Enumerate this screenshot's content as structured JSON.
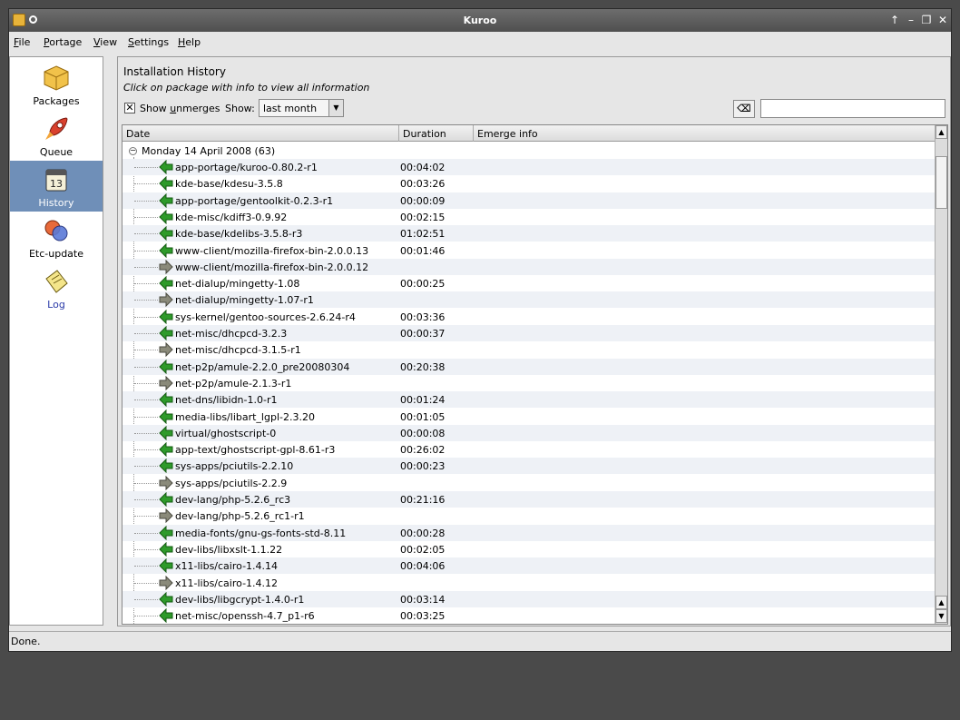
{
  "window": {
    "title": "Kuroo"
  },
  "menu": [
    {
      "key": "F",
      "rest": "ile"
    },
    {
      "key": "P",
      "rest": "ortage"
    },
    {
      "key": "V",
      "rest": "iew"
    },
    {
      "key": "S",
      "rest": "ettings"
    },
    {
      "key": "H",
      "rest": "elp"
    }
  ],
  "sidebar": {
    "items": [
      {
        "label": "Packages",
        "icon": "package-icon"
      },
      {
        "label": "Queue",
        "icon": "rocket-icon"
      },
      {
        "label": "History",
        "icon": "calendar-icon",
        "active": true
      },
      {
        "label": "Etc-update",
        "icon": "merge-icon"
      },
      {
        "label": "Log",
        "icon": "log-icon"
      }
    ]
  },
  "main": {
    "title": "Installation History",
    "subtitle": "Click on package with info to view all information",
    "show_unmerges": {
      "prefix": "Show ",
      "key": "u",
      "rest": "nmerges",
      "checked": true
    },
    "show_label": "Show:",
    "show_value": "last month"
  },
  "list": {
    "columns": [
      "Date",
      "Duration",
      "Emerge info"
    ],
    "group": {
      "label": "Monday 14 April 2008 (63)"
    },
    "rows": [
      {
        "package": "app-portage/kuroo-0.80.2-r1",
        "duration": "00:04:02",
        "type": "merge"
      },
      {
        "package": "kde-base/kdesu-3.5.8",
        "duration": "00:03:26",
        "type": "merge"
      },
      {
        "package": "app-portage/gentoolkit-0.2.3-r1",
        "duration": "00:00:09",
        "type": "merge"
      },
      {
        "package": "kde-misc/kdiff3-0.9.92",
        "duration": "00:02:15",
        "type": "merge"
      },
      {
        "package": "kde-base/kdelibs-3.5.8-r3",
        "duration": "01:02:51",
        "type": "merge"
      },
      {
        "package": "www-client/mozilla-firefox-bin-2.0.0.13",
        "duration": "00:01:46",
        "type": "merge"
      },
      {
        "package": "www-client/mozilla-firefox-bin-2.0.0.12",
        "duration": "",
        "type": "unmerge"
      },
      {
        "package": "net-dialup/mingetty-1.08",
        "duration": "00:00:25",
        "type": "merge"
      },
      {
        "package": "net-dialup/mingetty-1.07-r1",
        "duration": "",
        "type": "unmerge"
      },
      {
        "package": "sys-kernel/gentoo-sources-2.6.24-r4",
        "duration": "00:03:36",
        "type": "merge"
      },
      {
        "package": "net-misc/dhcpcd-3.2.3",
        "duration": "00:00:37",
        "type": "merge"
      },
      {
        "package": "net-misc/dhcpcd-3.1.5-r1",
        "duration": "",
        "type": "unmerge"
      },
      {
        "package": "net-p2p/amule-2.2.0_pre20080304",
        "duration": "00:20:38",
        "type": "merge"
      },
      {
        "package": "net-p2p/amule-2.1.3-r1",
        "duration": "",
        "type": "unmerge"
      },
      {
        "package": "net-dns/libidn-1.0-r1",
        "duration": "00:01:24",
        "type": "merge"
      },
      {
        "package": "media-libs/libart_lgpl-2.3.20",
        "duration": "00:01:05",
        "type": "merge"
      },
      {
        "package": "virtual/ghostscript-0",
        "duration": "00:00:08",
        "type": "merge"
      },
      {
        "package": "app-text/ghostscript-gpl-8.61-r3",
        "duration": "00:26:02",
        "type": "merge"
      },
      {
        "package": "sys-apps/pciutils-2.2.10",
        "duration": "00:00:23",
        "type": "merge"
      },
      {
        "package": "sys-apps/pciutils-2.2.9",
        "duration": "",
        "type": "unmerge"
      },
      {
        "package": "dev-lang/php-5.2.6_rc3",
        "duration": "00:21:16",
        "type": "merge"
      },
      {
        "package": "dev-lang/php-5.2.6_rc1-r1",
        "duration": "",
        "type": "unmerge"
      },
      {
        "package": "media-fonts/gnu-gs-fonts-std-8.11",
        "duration": "00:00:28",
        "type": "merge"
      },
      {
        "package": "dev-libs/libxslt-1.1.22",
        "duration": "00:02:05",
        "type": "merge"
      },
      {
        "package": "x11-libs/cairo-1.4.14",
        "duration": "00:04:06",
        "type": "merge"
      },
      {
        "package": "x11-libs/cairo-1.4.12",
        "duration": "",
        "type": "unmerge"
      },
      {
        "package": "dev-libs/libgcrypt-1.4.0-r1",
        "duration": "00:03:14",
        "type": "merge"
      },
      {
        "package": "net-misc/openssh-4.7_p1-r6",
        "duration": "00:03:25",
        "type": "merge"
      }
    ]
  },
  "colors": {
    "merge": "#2e9a2a",
    "unmerge": "#8a8a7a",
    "active_sidebar": "#6f8fb8"
  },
  "status": "Done."
}
